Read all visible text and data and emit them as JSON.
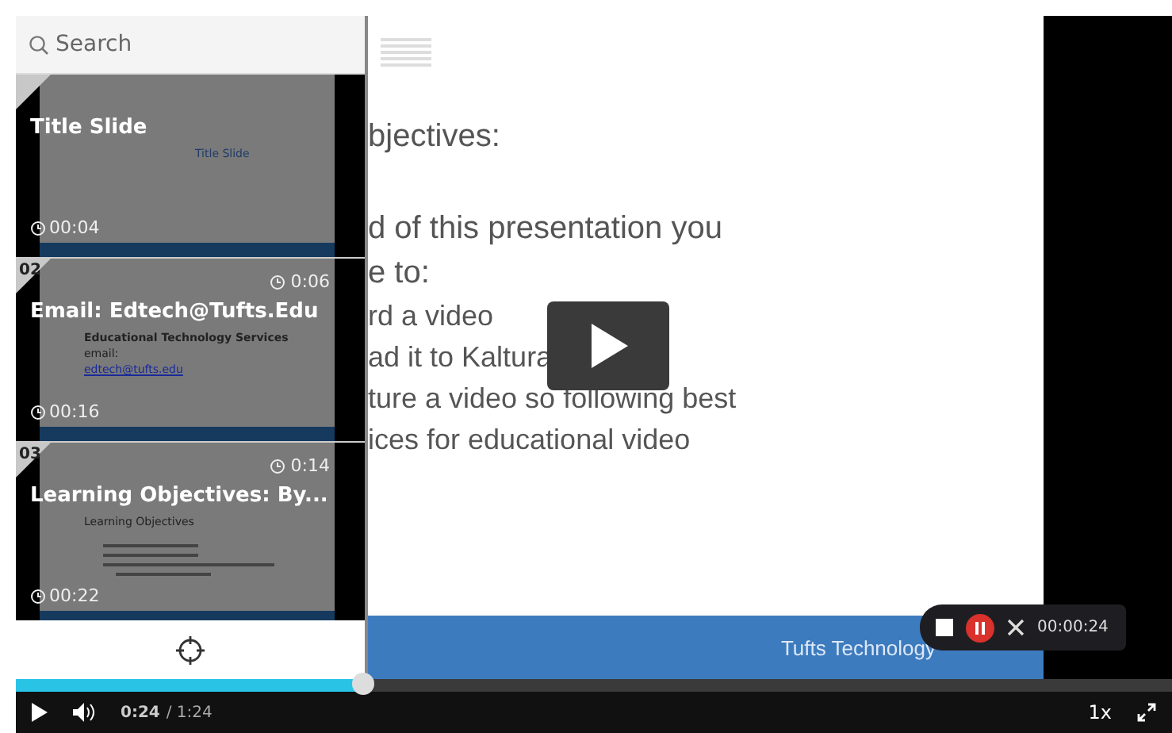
{
  "search": {
    "placeholder": "Search"
  },
  "chapters": [
    {
      "title": "Title Slide",
      "start": "00:04",
      "preview": [
        {
          "text": "Title Slide",
          "kind": "title"
        }
      ],
      "list_lines": false
    },
    {
      "number": "02",
      "duration": "0:06",
      "title": "Email: Edtech@Tufts.Edu",
      "start": "00:16",
      "preview": [
        {
          "text": "Educational Technology Services",
          "kind": "heading"
        },
        {
          "text": "email:",
          "kind": "plain"
        },
        {
          "text": "edtech@tufts.edu",
          "kind": "link"
        }
      ],
      "list_lines": false
    },
    {
      "number": "03",
      "duration": "0:14",
      "title": "Learning Objectives:   By...",
      "start": "00:22",
      "preview": [
        {
          "text": "Learning Objectives",
          "kind": "plain"
        }
      ],
      "list_lines": true
    }
  ],
  "slide": {
    "lines": [
      {
        "text": "bjectives:",
        "kind": "heading"
      },
      {
        "text": "d of this presentation you",
        "kind": "body"
      },
      {
        "text": "e to:",
        "kind": "body"
      },
      {
        "text": "rd a video",
        "kind": "item"
      },
      {
        "text": "ad it to Kaltura",
        "kind": "item"
      },
      {
        "text": "ture a video so following best",
        "kind": "item"
      },
      {
        "text": "ices for educational video",
        "kind": "item"
      }
    ],
    "footer": "Tufts Technology"
  },
  "recorder": {
    "time": "00:00:24"
  },
  "player": {
    "progress": {
      "level": 0.3
    },
    "current_time": "0:24",
    "duration": "/ 1:24",
    "speed": "1x"
  }
}
